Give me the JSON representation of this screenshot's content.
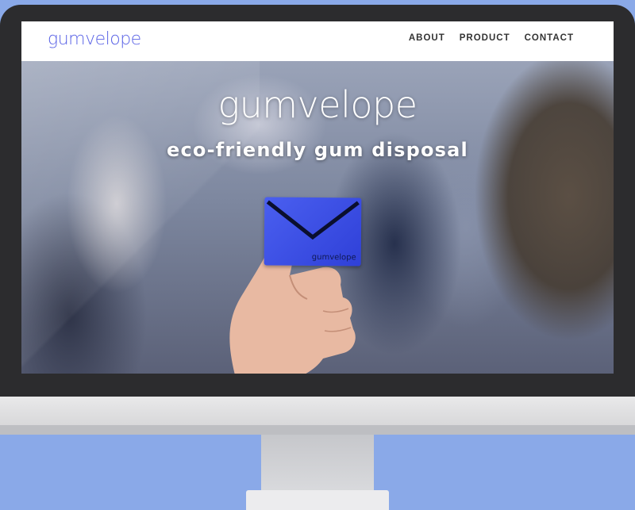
{
  "navbar": {
    "logo": "gumvelope",
    "links": [
      {
        "label": "ABOUT"
      },
      {
        "label": "PRODUCT"
      },
      {
        "label": "CONTACT"
      }
    ]
  },
  "hero": {
    "title": "gumvelope",
    "tagline": "eco-friendly gum disposal",
    "card_label": "gumvelope"
  },
  "colors": {
    "background": "#8aa9e8",
    "brand": "#5a63e6",
    "card": "#3a4ee6"
  },
  "icons": {
    "envelope": "envelope-icon"
  }
}
